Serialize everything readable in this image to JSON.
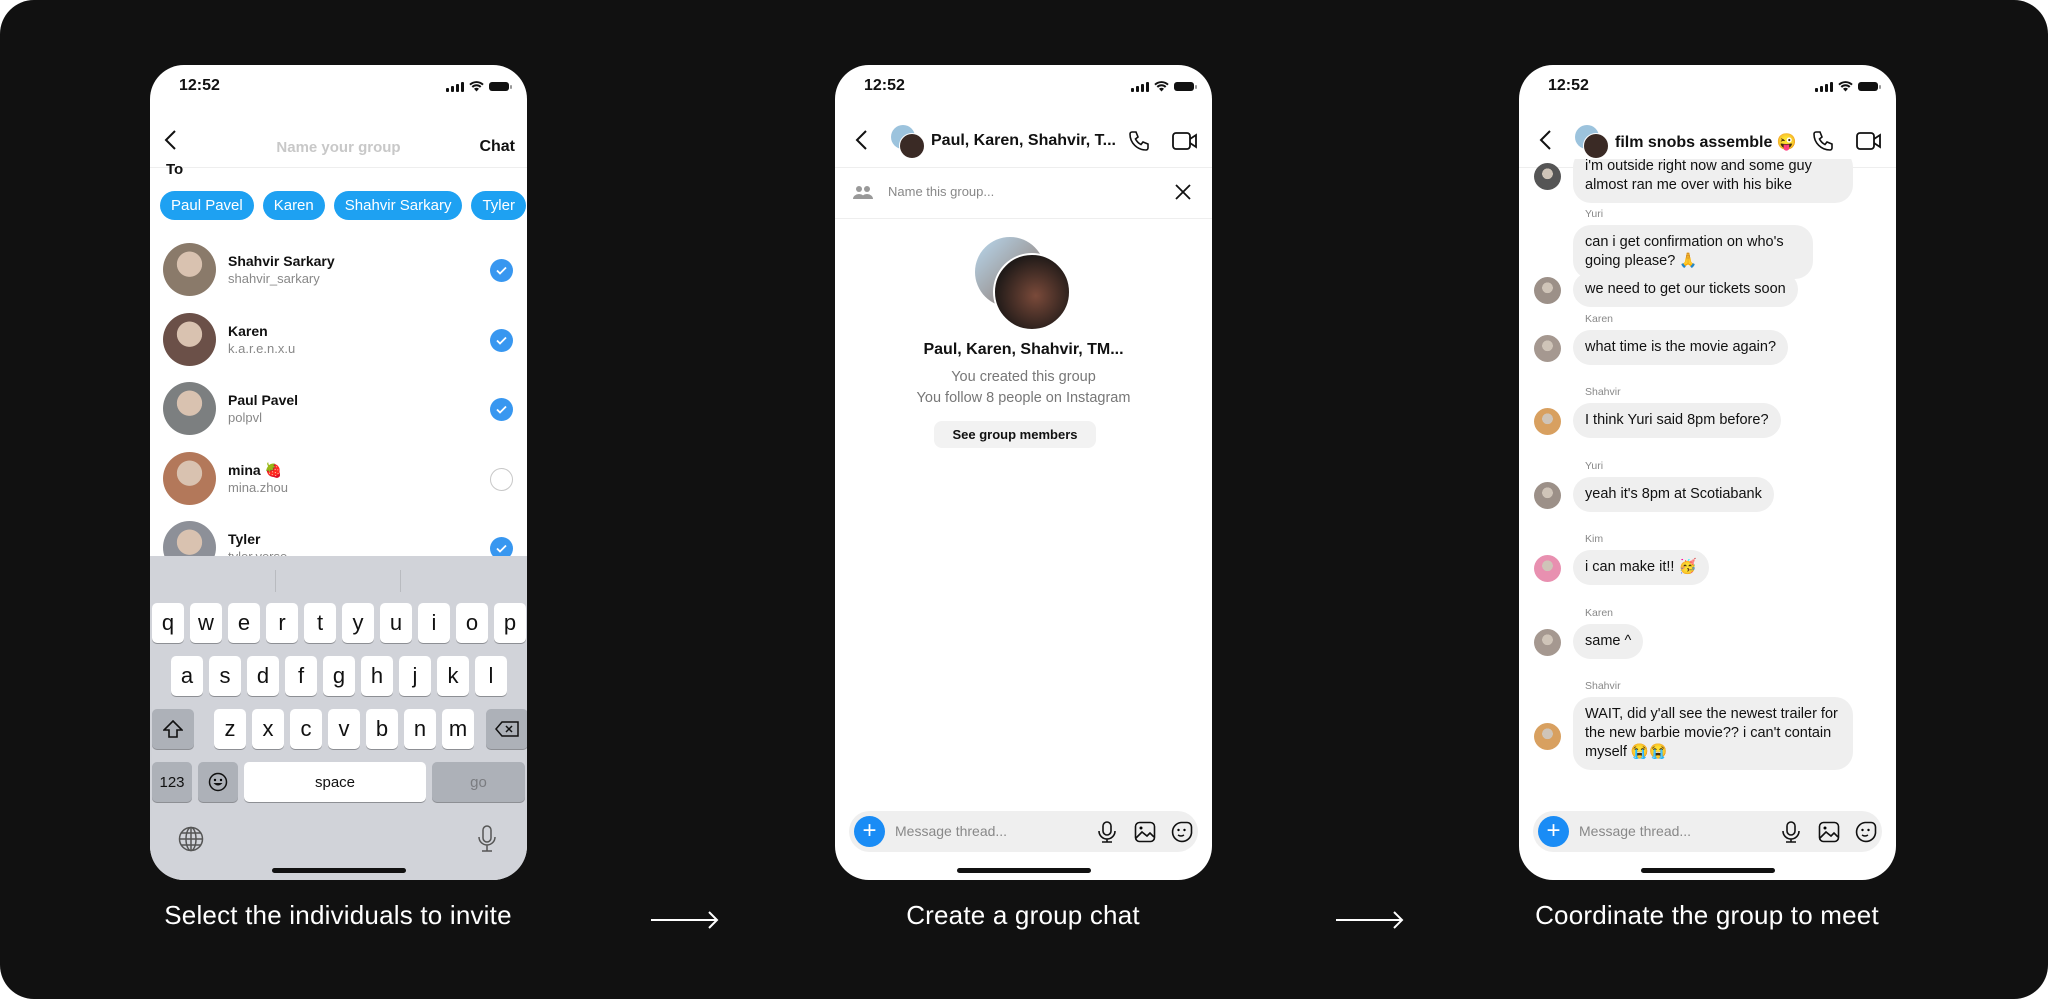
{
  "status_time": "12:52",
  "captions": [
    "Select the individuals to invite",
    "Create a group chat",
    "Coordinate the group to meet"
  ],
  "screen1": {
    "title_placeholder": "Name your group",
    "chat_button": "Chat",
    "to_label": "To",
    "chips": [
      "Paul Pavel",
      "Karen",
      "Shahvir Sarkary",
      "Tyler"
    ],
    "contacts": [
      {
        "name": "Shahvir Sarkary",
        "handle": "shahvir_sarkary",
        "selected": true,
        "color": "#8a7a6a"
      },
      {
        "name": "Karen",
        "handle": "k.a.r.e.n.x.u",
        "selected": true,
        "color": "#6b5048"
      },
      {
        "name": "Paul Pavel",
        "handle": "polpvl",
        "selected": true,
        "color": "#7c7f80"
      },
      {
        "name": "mina 🍓",
        "handle": "mina.zhou",
        "selected": false,
        "color": "#b3785a"
      },
      {
        "name": "Tyler",
        "handle": "tyler.verse",
        "selected": true,
        "color": "#8d9098"
      }
    ],
    "keyboard": {
      "row1": [
        "q",
        "w",
        "e",
        "r",
        "t",
        "y",
        "u",
        "i",
        "o",
        "p"
      ],
      "row2": [
        "a",
        "s",
        "d",
        "f",
        "g",
        "h",
        "j",
        "k",
        "l"
      ],
      "row3": [
        "z",
        "x",
        "c",
        "v",
        "b",
        "n",
        "m"
      ],
      "numbers": "123",
      "space": "space",
      "go": "go"
    }
  },
  "screen2": {
    "header_title": "Paul, Karen, Shahvir, T...",
    "name_placeholder": "Name this group...",
    "group_title": "Paul, Karen, Shahvir, TM...",
    "created": "You created this group",
    "follow": "You follow 8 people on Instagram",
    "members_button": "See group members",
    "message_placeholder": "Message thread..."
  },
  "screen3": {
    "header_title": "film snobs assemble 😜",
    "message_placeholder": "Message thread...",
    "messages": [
      {
        "sender": "",
        "text": "i'm outside right now and some guy almost ran me over with his bike"
      },
      {
        "sender": "Yuri",
        "text": "can i get confirmation on who's going please? 🙏"
      },
      {
        "sender": "",
        "text": "we need to get our tickets soon"
      },
      {
        "sender": "Karen",
        "text": "what time is the movie again?"
      },
      {
        "sender": "Shahvir",
        "text": "I think Yuri said 8pm before?"
      },
      {
        "sender": "Yuri",
        "text": "yeah it's 8pm at Scotiabank"
      },
      {
        "sender": "Kim",
        "text": "i can make it!! 🥳"
      },
      {
        "sender": "Karen",
        "text": "same ^"
      },
      {
        "sender": "Shahvir",
        "text": "WAIT, did y'all see the newest trailer for the new barbie movie?? i can't contain myself 😭😭"
      }
    ]
  },
  "colors": {
    "accent": "#3897f0",
    "chip": "#1ea1f2",
    "background": "#111111"
  }
}
